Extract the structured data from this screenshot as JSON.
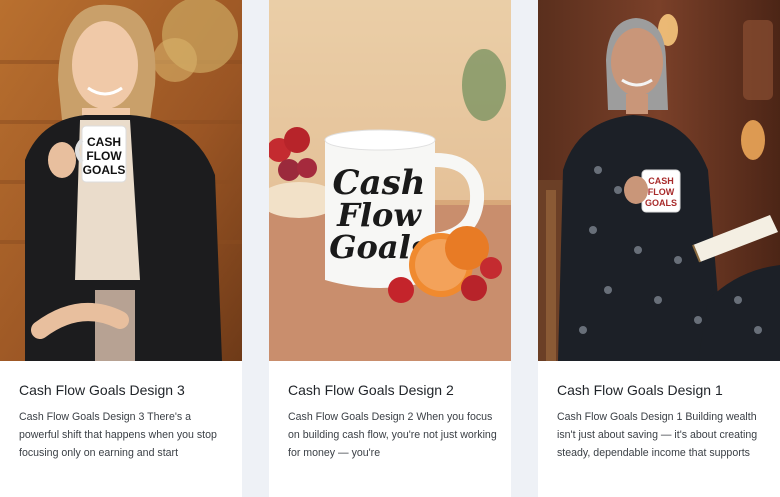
{
  "cards": [
    {
      "title": "Cash Flow Goals Design 3",
      "excerpt": "Cash Flow Goals Design 3 There's a powerful shift that happens when you stop focusing only on earning and start",
      "mug_text": [
        "CASH",
        "FLOW",
        "GOALS"
      ]
    },
    {
      "title": "Cash Flow Goals Design 2",
      "excerpt": "Cash Flow Goals Design 2 When you focus on building cash flow, you're not just working for money — you're",
      "mug_text": [
        "Cash",
        "Flow",
        "Goals"
      ]
    },
    {
      "title": "Cash Flow Goals Design 1",
      "excerpt": "Cash Flow Goals Design 1 Building wealth isn't just about saving — it's about creating steady, dependable income that supports",
      "mug_text": [
        "CASH",
        "FLOW",
        "GOALS"
      ]
    }
  ]
}
